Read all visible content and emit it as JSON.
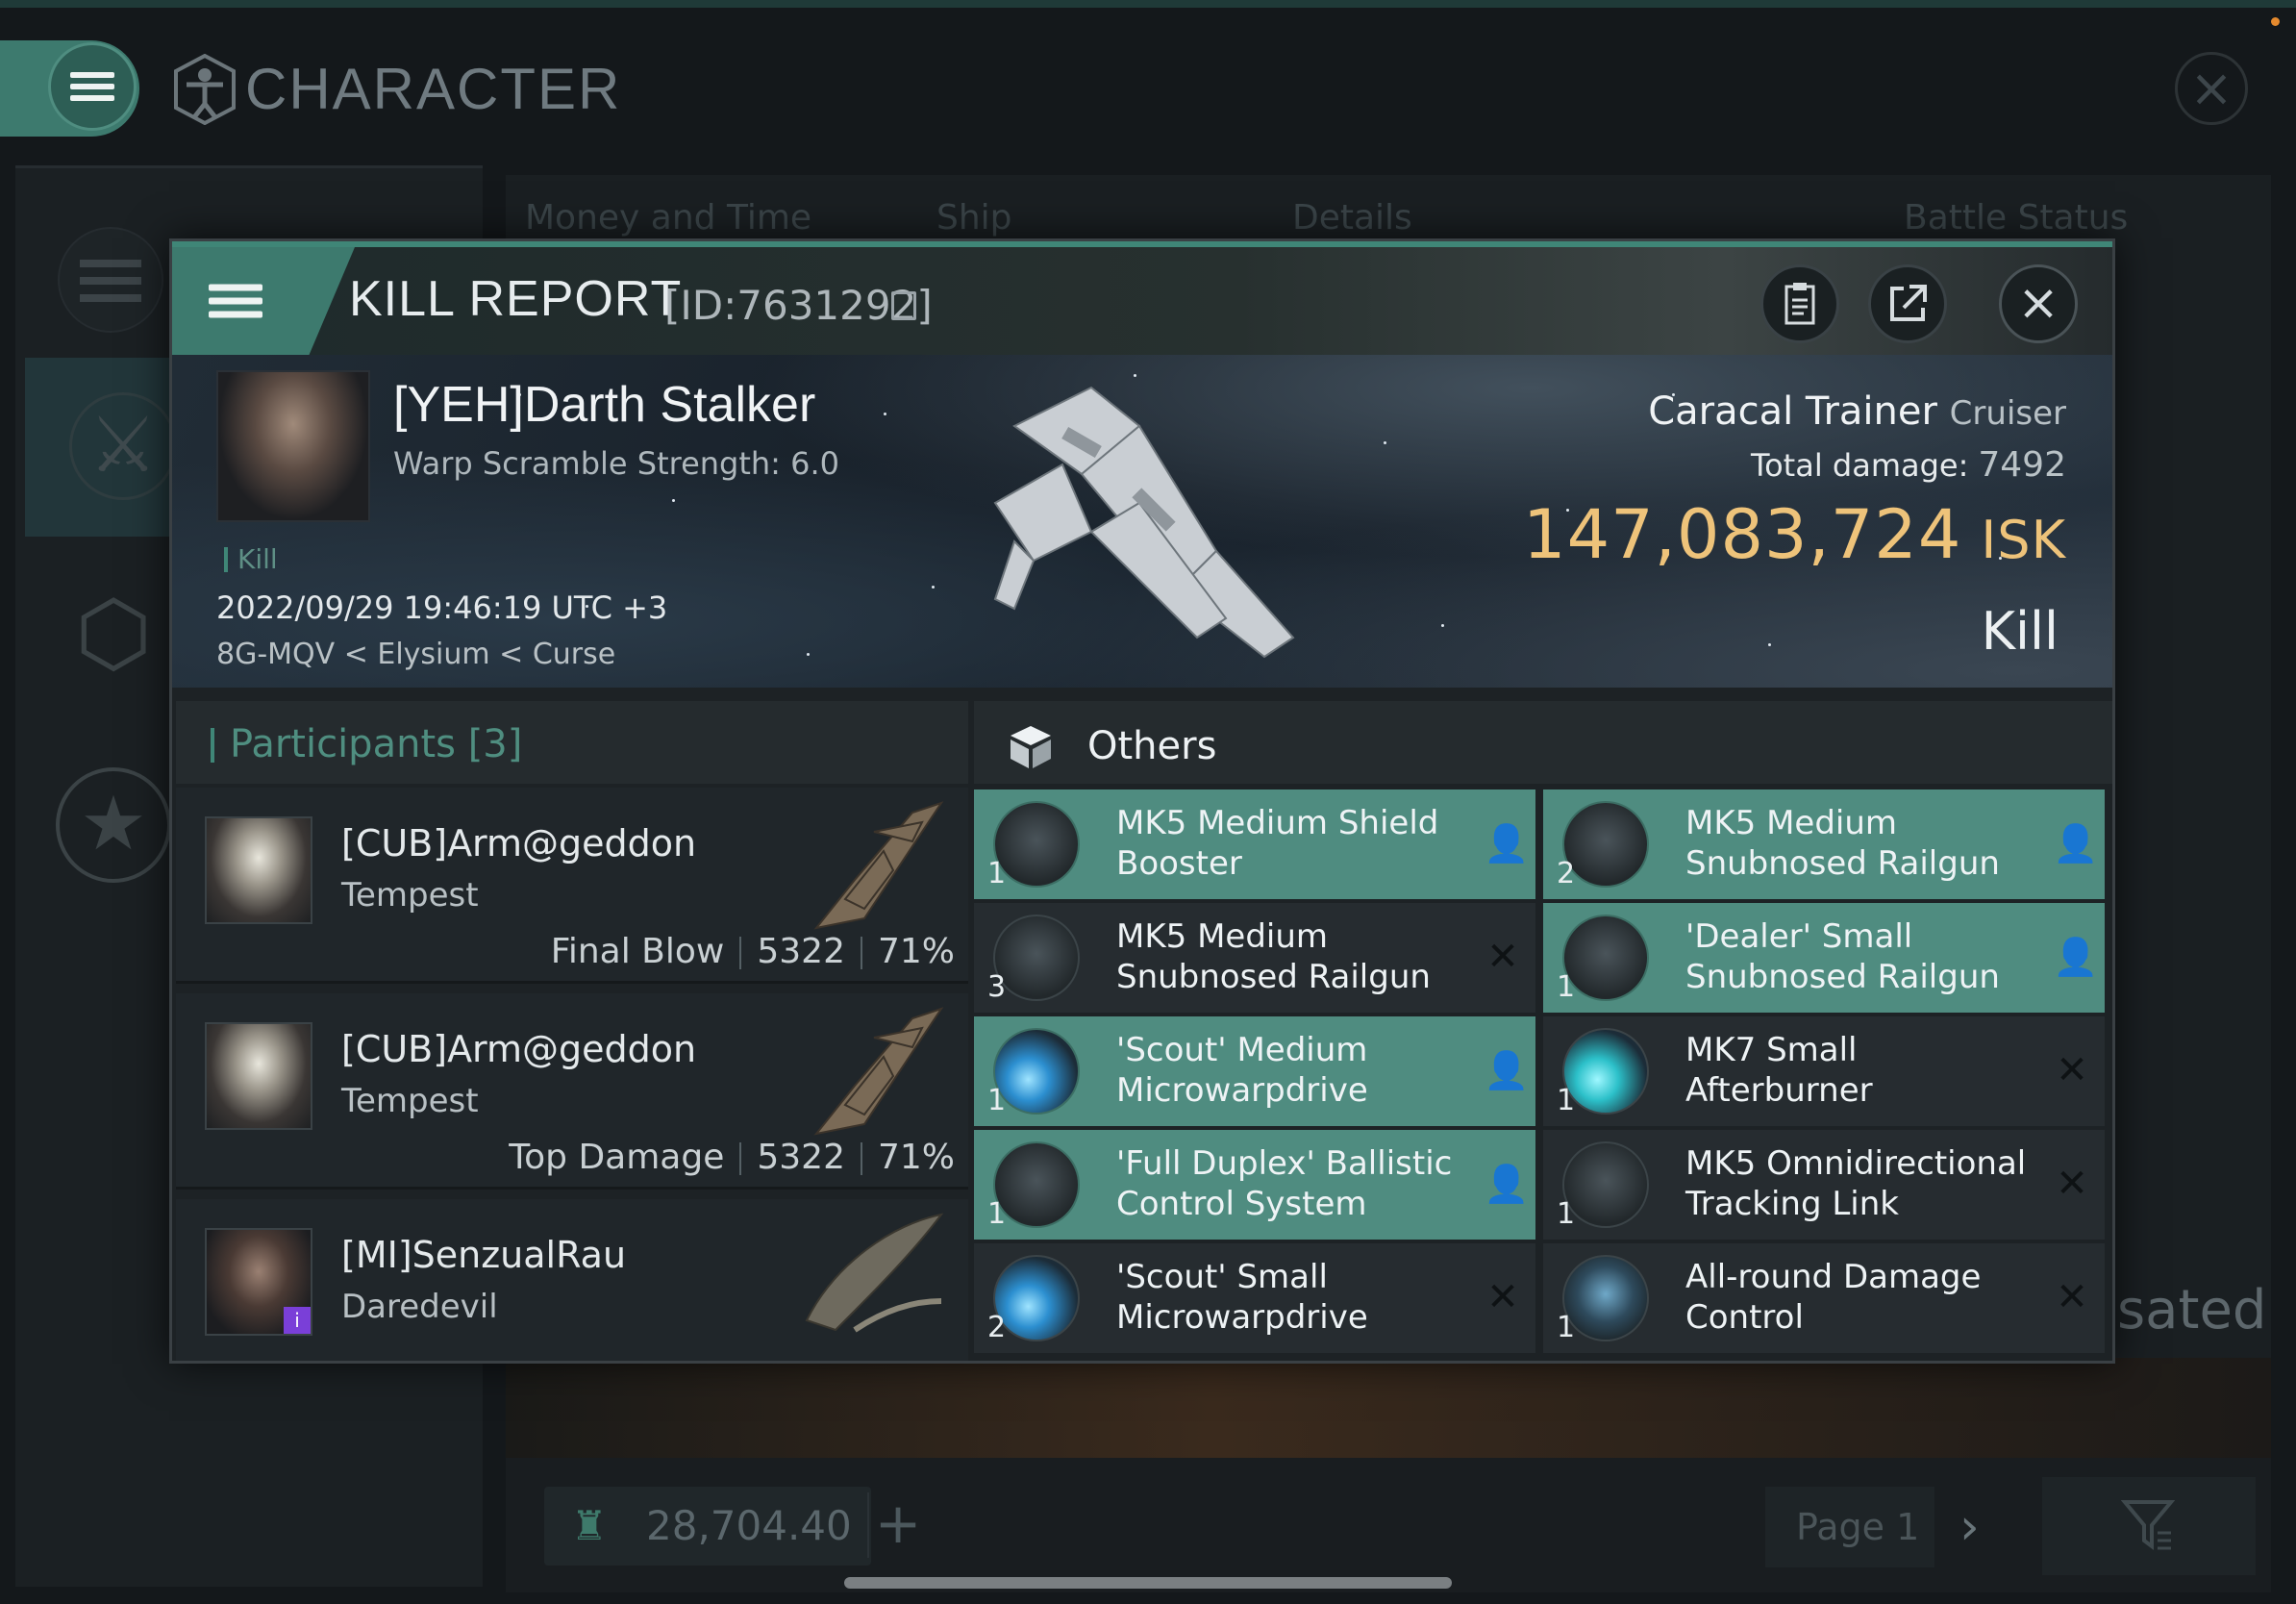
{
  "app": {
    "window_title": "CHARACTER",
    "bg_tabs": [
      "Money and Time",
      "Ship",
      "Details",
      "Battle Status"
    ],
    "bg_partial_text": "sated",
    "wallet_value": "28,704.40",
    "page_label": "Page 1"
  },
  "kill_report": {
    "title": "KILL REPORT",
    "id": "[ID:7631292]",
    "victim": {
      "name": "[YEH]Darth Stalker",
      "warp_scramble": "Warp Scramble Strength: 6.0",
      "tag": "Kill",
      "datetime": "2022/09/29 19:46:19 UTC +3",
      "location": "8G-MQV < Elysium < Curse"
    },
    "ship": {
      "name": "Caracal Trainer",
      "class": "Cruiser",
      "total_damage_label": "Total damage:",
      "total_damage": "7492",
      "isk_value": "147,083,724",
      "isk_unit": "ISK",
      "result": "Kill"
    },
    "participants": {
      "label": "Participants",
      "count": "[3]",
      "rows": [
        {
          "name": "[CUB]Arm@geddon",
          "ship": "Tempest",
          "role": "Final Blow",
          "damage": "5322",
          "percent": "71%"
        },
        {
          "name": "[CUB]Arm@geddon",
          "ship": "Tempest",
          "role": "Top Damage",
          "damage": "5322",
          "percent": "71%"
        },
        {
          "name": "[MI]SenzualRau",
          "ship": "Daredevil",
          "role": "",
          "damage": "",
          "percent": ""
        }
      ]
    },
    "others": {
      "title": "Others",
      "items": [
        {
          "qty": "1",
          "name": "MK5 Medium Shield Booster",
          "status": "fitted"
        },
        {
          "qty": "2",
          "name": "MK5 Medium Snubnosed Railgun",
          "status": "fitted"
        },
        {
          "qty": "3",
          "name": "MK5 Medium Snubnosed Railgun",
          "status": "destroyed"
        },
        {
          "qty": "1",
          "name": "'Dealer' Small Snubnosed Railgun",
          "status": "fitted"
        },
        {
          "qty": "1",
          "name": "'Scout' Medium Microwarpdrive",
          "status": "fitted"
        },
        {
          "qty": "1",
          "name": "MK7 Small Afterburner",
          "status": "destroyed"
        },
        {
          "qty": "1",
          "name": "'Full Duplex' Ballistic Control System",
          "status": "fitted"
        },
        {
          "qty": "1",
          "name": "MK5 Omnidirectional Tracking Link",
          "status": "destroyed"
        },
        {
          "qty": "2",
          "name": "'Scout' Small Microwarpdrive",
          "status": "destroyed"
        },
        {
          "qty": "1",
          "name": "All-round Damage Control",
          "status": "destroyed"
        }
      ]
    }
  },
  "icons": {
    "menu": "hamburger-icon",
    "character": "character-emblem-icon",
    "close": "close-icon",
    "copy": "copy-icon",
    "clipboard": "clipboard-icon",
    "share": "share-icon",
    "cube": "cube-icon",
    "pilot": "pilot-icon",
    "destroyed": "x-icon"
  },
  "colors": {
    "accent": "#3f8677",
    "fitted_bg": "#4f8c80",
    "isk_gold": "#eec37a"
  }
}
